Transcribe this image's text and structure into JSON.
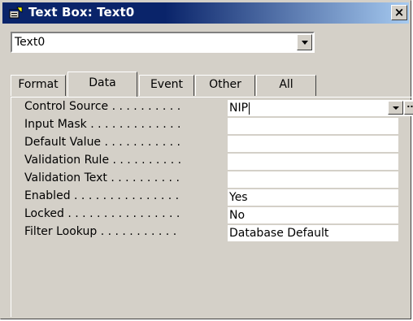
{
  "window": {
    "title": "Text Box: Text0",
    "close_glyph": "×",
    "icon": "properties-window-icon"
  },
  "object_selector": {
    "value": "Text0"
  },
  "tabs": [
    {
      "label": "Format",
      "active": false
    },
    {
      "label": "Data",
      "active": true
    },
    {
      "label": "Event",
      "active": false
    },
    {
      "label": "Other",
      "active": false
    },
    {
      "label": "All",
      "active": false
    }
  ],
  "properties": [
    {
      "label": "Control Source . . . . . . . . . .",
      "value": "NIP"
    },
    {
      "label": "Input Mask . . . . . . . . . . . . .",
      "value": ""
    },
    {
      "label": "Default Value . . . . . . . . . . .",
      "value": ""
    },
    {
      "label": "Validation Rule . . . . . . . . . .",
      "value": ""
    },
    {
      "label": "Validation Text . . . . . . . . . .",
      "value": ""
    },
    {
      "label": "Enabled . . . . . . . . . . . . . . .",
      "value": "Yes"
    },
    {
      "label": "Locked . . . . . . . . . . . . . . . .",
      "value": "No"
    },
    {
      "label": "Filter Lookup . . . . . . . . . . .",
      "value": "Database Default"
    }
  ],
  "builder_button_label": "..."
}
